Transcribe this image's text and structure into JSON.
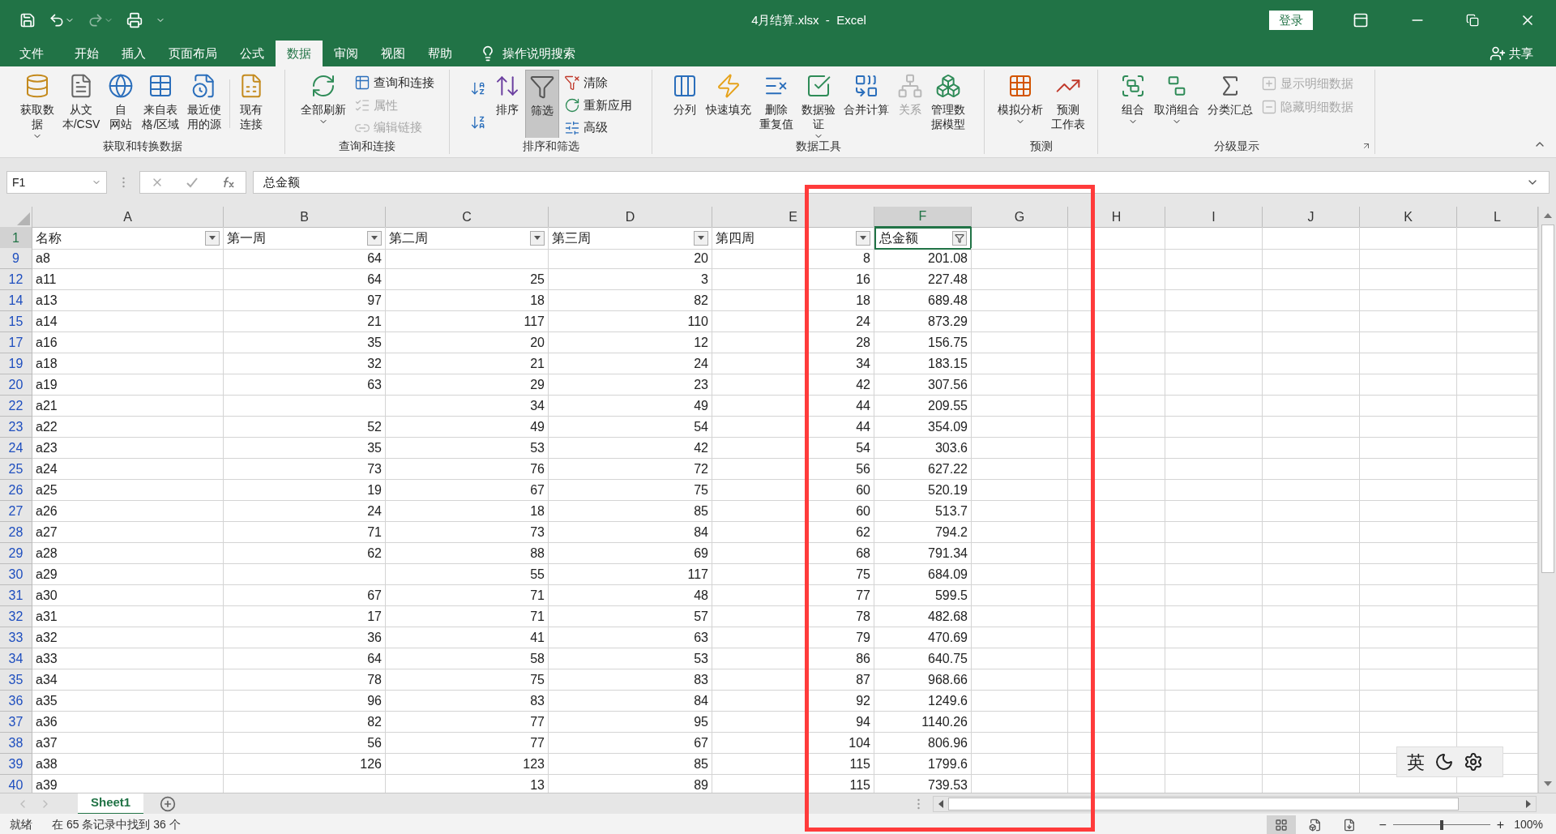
{
  "title_bar": {
    "title": "4月结算.xlsx  -  Excel",
    "sign_in": "登录"
  },
  "menu_tabs": [
    {
      "label": "文件",
      "selected": false
    },
    {
      "label": "开始",
      "selected": false
    },
    {
      "label": "插入",
      "selected": false
    },
    {
      "label": "页面布局",
      "selected": false
    },
    {
      "label": "公式",
      "selected": false
    },
    {
      "label": "数据",
      "selected": true
    },
    {
      "label": "审阅",
      "selected": false
    },
    {
      "label": "视图",
      "selected": false
    },
    {
      "label": "帮助",
      "selected": false
    }
  ],
  "tell_me": "操作说明搜索",
  "share": "共享",
  "ribbon_groups": [
    {
      "title": "获取和转换数据",
      "launcher": false,
      "items": [
        {
          "kind": "large",
          "label": [
            "获取数",
            "据"
          ],
          "dropdown": true,
          "disabled": false,
          "pressed": false
        },
        {
          "kind": "large",
          "label": [
            "从文",
            "本/CSV"
          ],
          "dropdown": false,
          "disabled": false,
          "pressed": false
        },
        {
          "kind": "large",
          "label": [
            "自",
            "网站"
          ],
          "dropdown": false,
          "disabled": false,
          "pressed": false
        },
        {
          "kind": "large",
          "label": [
            "来自表",
            "格/区域"
          ],
          "dropdown": false,
          "disabled": false,
          "pressed": false
        },
        {
          "kind": "large",
          "label": [
            "最近使",
            "用的源"
          ],
          "dropdown": false,
          "disabled": false,
          "pressed": false
        },
        {
          "kind": "separator"
        },
        {
          "kind": "large",
          "label": [
            "现有",
            "连接"
          ],
          "dropdown": false,
          "disabled": false,
          "pressed": false
        }
      ]
    },
    {
      "title": "查询和连接",
      "launcher": false,
      "items": [
        {
          "kind": "large",
          "label": [
            "全部刷新"
          ],
          "dropdown": true,
          "disabled": false,
          "pressed": false
        },
        {
          "kind": "stack",
          "children": [
            {
              "label": "查询和连接",
              "disabled": false
            },
            {
              "label": "属性",
              "disabled": true
            },
            {
              "label": "编辑链接",
              "disabled": true
            }
          ]
        }
      ]
    },
    {
      "title": "排序和筛选",
      "launcher": false,
      "items": [
        {
          "kind": "stack",
          "children": [
            {
              "disabled": false
            },
            {
              "disabled": false
            }
          ]
        },
        {
          "kind": "large",
          "label": [
            "排序"
          ],
          "dropdown": false,
          "disabled": false,
          "pressed": false
        },
        {
          "kind": "large",
          "label": [
            "筛选"
          ],
          "dropdown": false,
          "disabled": false,
          "pressed": true
        },
        {
          "kind": "stack",
          "children": [
            {
              "label": "清除",
              "disabled": false
            },
            {
              "label": "重新应用",
              "disabled": false
            },
            {
              "label": "高级",
              "disabled": false
            }
          ]
        }
      ]
    },
    {
      "title": "数据工具",
      "launcher": false,
      "items": [
        {
          "kind": "large",
          "label": [
            "分列"
          ],
          "dropdown": false,
          "disabled": false,
          "pressed": false
        },
        {
          "kind": "large",
          "label": [
            "快速填充"
          ],
          "dropdown": false,
          "disabled": false,
          "pressed": false
        },
        {
          "kind": "large",
          "label": [
            "删除",
            "重复值"
          ],
          "dropdown": false,
          "disabled": false,
          "pressed": false
        },
        {
          "kind": "large",
          "label": [
            "数据验",
            "证"
          ],
          "dropdown": true,
          "disabled": false,
          "pressed": false
        },
        {
          "kind": "large",
          "label": [
            "合并计算"
          ],
          "dropdown": false,
          "disabled": false,
          "pressed": false
        },
        {
          "kind": "large",
          "label": [
            "关系"
          ],
          "dropdown": false,
          "disabled": true,
          "pressed": false
        },
        {
          "kind": "large",
          "label": [
            "管理数",
            "据模型"
          ],
          "dropdown": false,
          "disabled": false,
          "pressed": false
        }
      ]
    },
    {
      "title": "预测",
      "launcher": false,
      "items": [
        {
          "kind": "large",
          "label": [
            "模拟分析"
          ],
          "dropdown": true,
          "disabled": false,
          "pressed": false
        },
        {
          "kind": "large",
          "label": [
            "预测",
            "工作表"
          ],
          "dropdown": false,
          "disabled": false,
          "pressed": false
        }
      ]
    },
    {
      "title": "分级显示",
      "launcher": true,
      "items": [
        {
          "kind": "large",
          "label": [
            "组合"
          ],
          "dropdown": true,
          "disabled": false,
          "pressed": false
        },
        {
          "kind": "large",
          "label": [
            "取消组合"
          ],
          "dropdown": true,
          "disabled": false,
          "pressed": false
        },
        {
          "kind": "large",
          "label": [
            "分类汇总"
          ],
          "dropdown": false,
          "disabled": false,
          "pressed": false
        },
        {
          "kind": "stack",
          "children": [
            {
              "label": "显示明细数据",
              "disabled": true
            },
            {
              "label": "隐藏明细数据",
              "disabled": true
            }
          ]
        }
      ]
    }
  ],
  "formula_bar": {
    "name_box": "F1",
    "content": "总金额"
  },
  "columns": [
    {
      "label": "A",
      "selected": false
    },
    {
      "label": "B",
      "selected": false
    },
    {
      "label": "C",
      "selected": false
    },
    {
      "label": "D",
      "selected": false
    },
    {
      "label": "E",
      "selected": false
    },
    {
      "label": "F",
      "selected": true
    },
    {
      "label": "G",
      "selected": false
    },
    {
      "label": "H",
      "selected": false
    },
    {
      "label": "I",
      "selected": false
    },
    {
      "label": "J",
      "selected": false
    },
    {
      "label": "K",
      "selected": false
    },
    {
      "label": "L",
      "selected": false
    }
  ],
  "header_row": {
    "number": "1",
    "selected": true,
    "cells": [
      {
        "text": "名称",
        "kind": "dropdown",
        "selected": false
      },
      {
        "text": "第一周",
        "kind": "dropdown",
        "selected": false
      },
      {
        "text": "第二周",
        "kind": "dropdown",
        "selected": false
      },
      {
        "text": "第三周",
        "kind": "dropdown",
        "selected": false
      },
      {
        "text": "第四周",
        "kind": "dropdown",
        "selected": false
      },
      {
        "text": "总金额",
        "kind": "active",
        "selected": true
      }
    ]
  },
  "rows": [
    {
      "number": "9",
      "cells": [
        "a8",
        "64",
        null,
        "20",
        "8",
        "201.08"
      ]
    },
    {
      "number": "12",
      "cells": [
        "a11",
        "64",
        "25",
        "3",
        "16",
        "227.48"
      ]
    },
    {
      "number": "14",
      "cells": [
        "a13",
        "97",
        "18",
        "82",
        "18",
        "689.48"
      ]
    },
    {
      "number": "15",
      "cells": [
        "a14",
        "21",
        "117",
        "110",
        "24",
        "873.29"
      ]
    },
    {
      "number": "17",
      "cells": [
        "a16",
        "35",
        "20",
        "12",
        "28",
        "156.75"
      ]
    },
    {
      "number": "19",
      "cells": [
        "a18",
        "32",
        "21",
        "24",
        "34",
        "183.15"
      ]
    },
    {
      "number": "20",
      "cells": [
        "a19",
        "63",
        "29",
        "23",
        "42",
        "307.56"
      ]
    },
    {
      "number": "22",
      "cells": [
        "a21",
        null,
        "34",
        "49",
        "44",
        "209.55"
      ]
    },
    {
      "number": "23",
      "cells": [
        "a22",
        "52",
        "49",
        "54",
        "44",
        "354.09"
      ]
    },
    {
      "number": "24",
      "cells": [
        "a23",
        "35",
        "53",
        "42",
        "54",
        "303.6"
      ]
    },
    {
      "number": "25",
      "cells": [
        "a24",
        "73",
        "76",
        "72",
        "56",
        "627.22"
      ]
    },
    {
      "number": "26",
      "cells": [
        "a25",
        "19",
        "67",
        "75",
        "60",
        "520.19"
      ]
    },
    {
      "number": "27",
      "cells": [
        "a26",
        "24",
        "18",
        "85",
        "60",
        "513.7"
      ]
    },
    {
      "number": "28",
      "cells": [
        "a27",
        "71",
        "73",
        "84",
        "62",
        "794.2"
      ]
    },
    {
      "number": "29",
      "cells": [
        "a28",
        "62",
        "88",
        "69",
        "68",
        "791.34"
      ]
    },
    {
      "number": "30",
      "cells": [
        "a29",
        null,
        "55",
        "117",
        "75",
        "684.09"
      ]
    },
    {
      "number": "31",
      "cells": [
        "a30",
        "67",
        "71",
        "48",
        "77",
        "599.5"
      ]
    },
    {
      "number": "32",
      "cells": [
        "a31",
        "17",
        "71",
        "57",
        "78",
        "482.68"
      ]
    },
    {
      "number": "33",
      "cells": [
        "a32",
        "36",
        "41",
        "63",
        "79",
        "470.69"
      ]
    },
    {
      "number": "34",
      "cells": [
        "a33",
        "64",
        "58",
        "53",
        "86",
        "640.75"
      ]
    },
    {
      "number": "35",
      "cells": [
        "a34",
        "78",
        "75",
        "83",
        "87",
        "968.66"
      ]
    },
    {
      "number": "36",
      "cells": [
        "a35",
        "96",
        "83",
        "84",
        "92",
        "1249.6"
      ]
    },
    {
      "number": "37",
      "cells": [
        "a36",
        "82",
        "77",
        "95",
        "94",
        "1140.26"
      ]
    },
    {
      "number": "38",
      "cells": [
        "a37",
        "56",
        "77",
        "67",
        "104",
        "806.96"
      ]
    },
    {
      "number": "39",
      "cells": [
        "a38",
        "126",
        "123",
        "85",
        "115",
        "1799.6"
      ]
    },
    {
      "number": "40",
      "cells": [
        "a39",
        null,
        "13",
        "89",
        "115",
        "739.53"
      ]
    }
  ],
  "sheet_tabs": [
    {
      "label": "Sheet1",
      "selected": true
    }
  ],
  "status_bar": {
    "mode": "就绪",
    "filter_info": "在 65 条记录中找到 36 个",
    "views": [
      {
        "selected": true
      },
      {
        "selected": false
      },
      {
        "selected": false
      }
    ],
    "zoom_out": "−",
    "zoom_in": "+",
    "zoom": {
      "level": 0.5
    },
    "zoom_text": "100%"
  },
  "ime": {
    "mode": "英"
  }
}
